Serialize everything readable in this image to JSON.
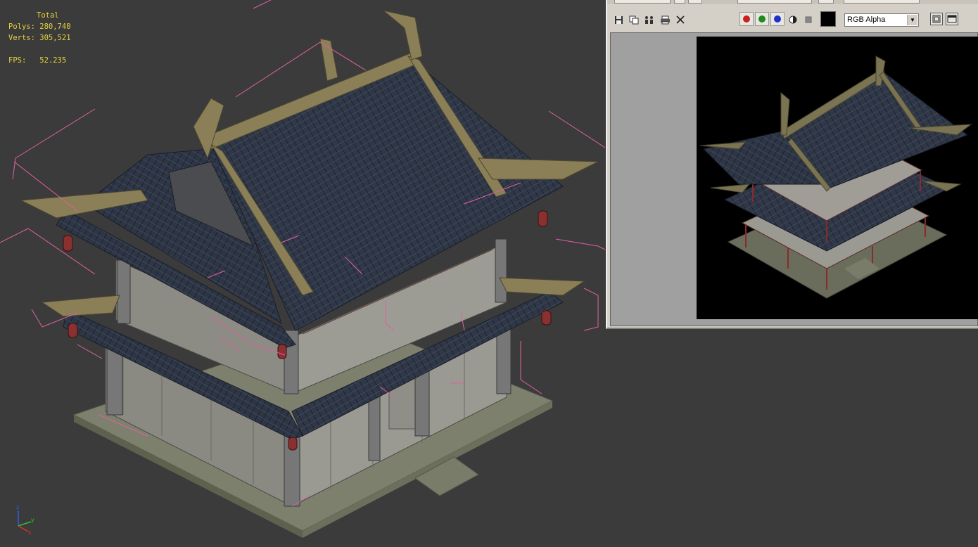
{
  "viewport": {
    "stats": {
      "total_label": "Total",
      "polys_label": "Polys:",
      "polys_value": "280,740",
      "verts_label": "Verts:",
      "verts_value": "305,521",
      "fps_label": "FPS:",
      "fps_value": "52.235"
    },
    "axis": {
      "x": "x",
      "y": "y",
      "z": "z"
    }
  },
  "render_window": {
    "toolbar": {
      "icons": [
        "save-icon",
        "clone-icon",
        "people-icon",
        "print-icon",
        "close-icon"
      ],
      "channels": [
        {
          "name": "red-channel",
          "color": "#cc1f1f"
        },
        {
          "name": "green-channel",
          "color": "#1f8a1f"
        },
        {
          "name": "blue-channel",
          "color": "#1f2fcc"
        }
      ],
      "channel_select_value": "RGB Alpha"
    }
  },
  "colors": {
    "viewport_bg": "#3b3b3b",
    "stats_text": "#e6d23c",
    "roof": "#2c3444",
    "wood": "#8a7f56",
    "wall": "#8e8e86",
    "selection": "#e060a0"
  }
}
